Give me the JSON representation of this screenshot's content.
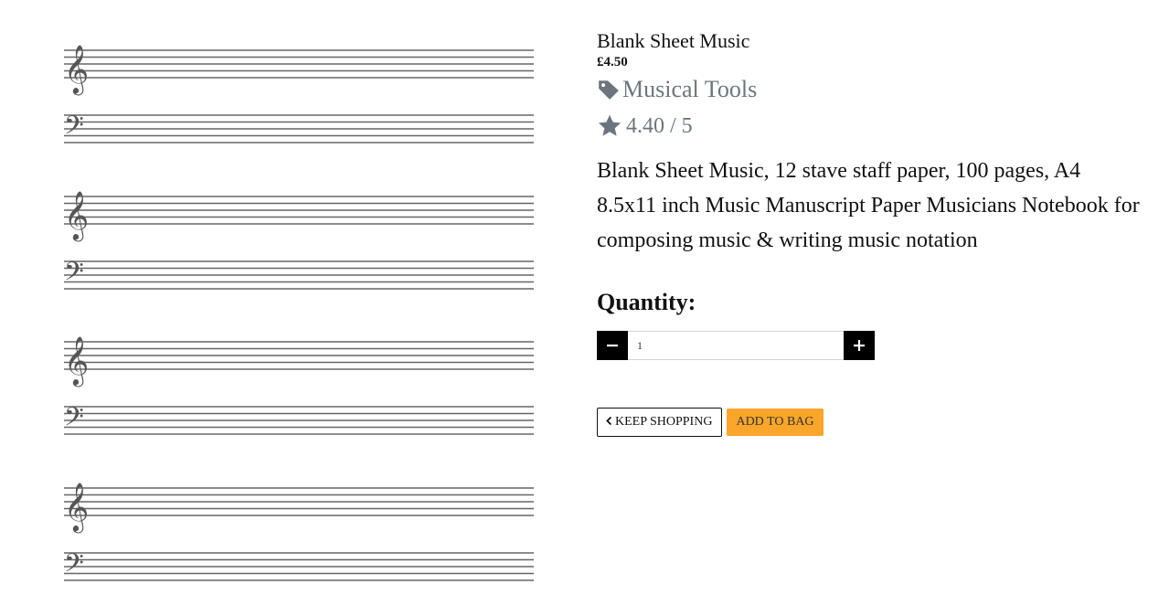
{
  "product": {
    "name": "Blank Sheet Music",
    "price": "£4.50",
    "category": "Musical Tools",
    "rating": "4.40 / 5",
    "description": "Blank Sheet Music, 12 stave staff paper, 100 pages, A4 8.5x11 inch Music Manuscript Paper Musicians Notebook for composing music & writing music notation"
  },
  "quantity": {
    "label": "Quantity:",
    "value": "1",
    "decrement_icon": "minus-icon",
    "increment_icon": "plus-icon"
  },
  "actions": {
    "keep_shopping_label": "KEEP SHOPPING",
    "add_to_bag_label": "ADD TO BAG",
    "keep_shopping_icon": "chevron-left-icon"
  },
  "icons": {
    "category": "tag-icon",
    "rating": "star-icon"
  },
  "colors": {
    "accent": "#f9a62b",
    "muted": "#6c757d",
    "button_dark": "#000000"
  }
}
